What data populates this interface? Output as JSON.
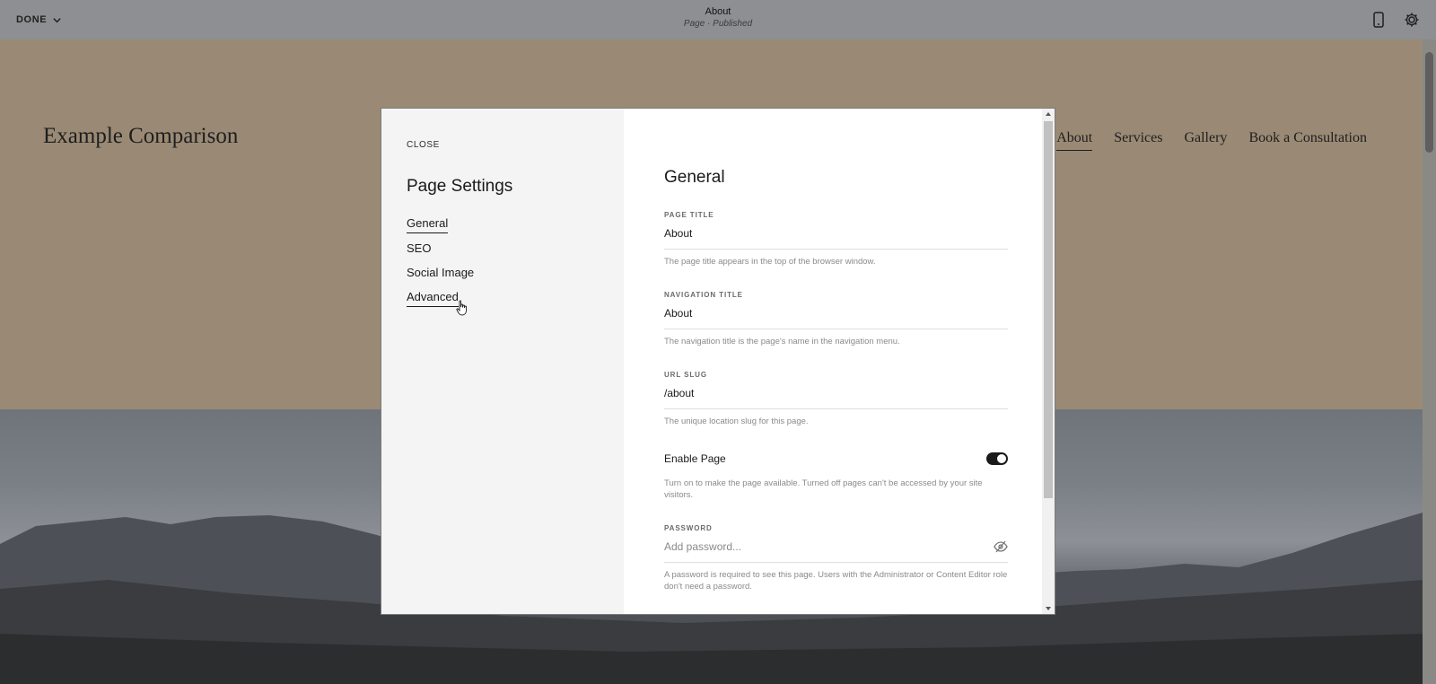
{
  "topbar": {
    "done_label": "DONE",
    "page_title": "About",
    "page_status": "Page · Published"
  },
  "site": {
    "logo": "Example Comparison",
    "nav": [
      "About",
      "Services",
      "Gallery",
      "Book a Consultation"
    ],
    "active_nav": "About"
  },
  "modal": {
    "close_label": "CLOSE",
    "title": "Page Settings",
    "tabs": [
      "General",
      "SEO",
      "Social Image",
      "Advanced"
    ],
    "active_tab": "General",
    "section_title": "General",
    "page_title": {
      "label": "PAGE TITLE",
      "value": "About",
      "help": "The page title appears in the top of the browser window."
    },
    "navigation_title": {
      "label": "NAVIGATION TITLE",
      "value": "About",
      "help": "The navigation title is the page's name in the navigation menu."
    },
    "url_slug": {
      "label": "URL SLUG",
      "value": "/about",
      "help": "The unique location slug for this page."
    },
    "enable_page": {
      "label": "Enable Page",
      "enabled": true,
      "help": "Turn on to make the page available. Turned off pages can't be accessed by your site visitors."
    },
    "password": {
      "label": "PASSWORD",
      "placeholder": "Add password...",
      "help": "A password is required to see this page. Users with the Administrator or Content Editor role don't need a password."
    }
  },
  "icons": {
    "done_chevron": "chevron-down-icon",
    "mobile_preview": "mobile-icon",
    "site_settings": "gear-icon",
    "password_visibility": "eye-off-icon",
    "pointer": "hand-cursor-icon"
  },
  "colors": {
    "toggle_on": "#1a1a1a",
    "header_bg": "#9a8a75",
    "topbar_bg": "#8d8f92"
  }
}
